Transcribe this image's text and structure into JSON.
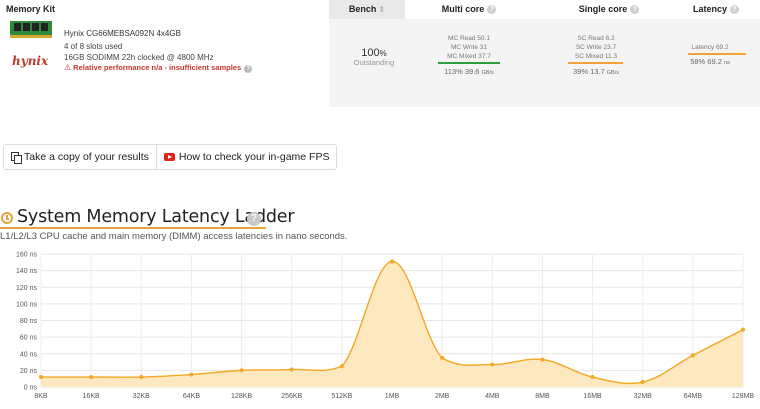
{
  "table": {
    "headers": {
      "kit": "Memory Kit",
      "bench": "Bench",
      "multi": "Multi core",
      "single": "Single core",
      "latency": "Latency"
    },
    "kit": {
      "brand_logo_text": "hynix",
      "name": "Hynix CG66MEBSA092N 4x4GB",
      "slots": "4 of 8 slots used",
      "spec": "16GB SODIMM 22h clocked @ 4800 MHz",
      "warning": "Relative performance n/a - insufficient samples"
    },
    "bench": {
      "value": "100",
      "pct_sign": "%",
      "label": "Outstanding"
    },
    "multi": {
      "read": "MC Read 50.1",
      "write": "MC Write 31",
      "mixed": "MC Mixed 37.7",
      "result": "113% 39.6",
      "unit": "GB/s",
      "bar_fraction": 1.0,
      "bar_color": "#2e9e3e"
    },
    "single": {
      "read": "SC Read 6.2",
      "write": "SC Write 23.7",
      "mixed": "SC Mixed 11.3",
      "result": "39% 13.7",
      "unit": "GB/s",
      "bar_fraction": 0.39,
      "bar_color": "#f0a33a"
    },
    "latency": {
      "value": "Latency 69.2",
      "result": "58% 69.2",
      "unit": "ns",
      "bar_fraction": 0.58,
      "bar_color": "#f0a33a"
    }
  },
  "buttons": {
    "copy": "Take a copy of your results",
    "howto": "How to check your in-game FPS"
  },
  "section": {
    "title": "System Memory Latency Ladder",
    "help": "?",
    "description": "L1/L2/L3 CPU cache and main memory (DIMM) access latencies in nano seconds."
  },
  "colors": {
    "accent": "#e8a33d",
    "line": "#f5a623",
    "fill": "#fde8bf",
    "warning": "#c0392b"
  },
  "chart_data": {
    "type": "area",
    "x": [
      "8KB",
      "16KB",
      "32KB",
      "64KB",
      "128KB",
      "256KB",
      "512KB",
      "1MB",
      "2MB",
      "4MB",
      "8MB",
      "16MB",
      "32MB",
      "64MB",
      "128MB"
    ],
    "values": [
      12,
      12,
      12,
      15,
      20,
      21,
      25,
      151,
      35,
      27,
      33,
      12,
      6,
      38,
      69
    ],
    "ylim": [
      0,
      160
    ],
    "yticks": [
      0,
      20,
      40,
      60,
      80,
      100,
      120,
      140,
      160
    ],
    "ytick_labels": [
      "0 ns",
      "20 ns",
      "40 ns",
      "60 ns",
      "80 ns",
      "100 ns",
      "120 ns",
      "140 ns",
      "160 ns"
    ],
    "grid": true
  }
}
